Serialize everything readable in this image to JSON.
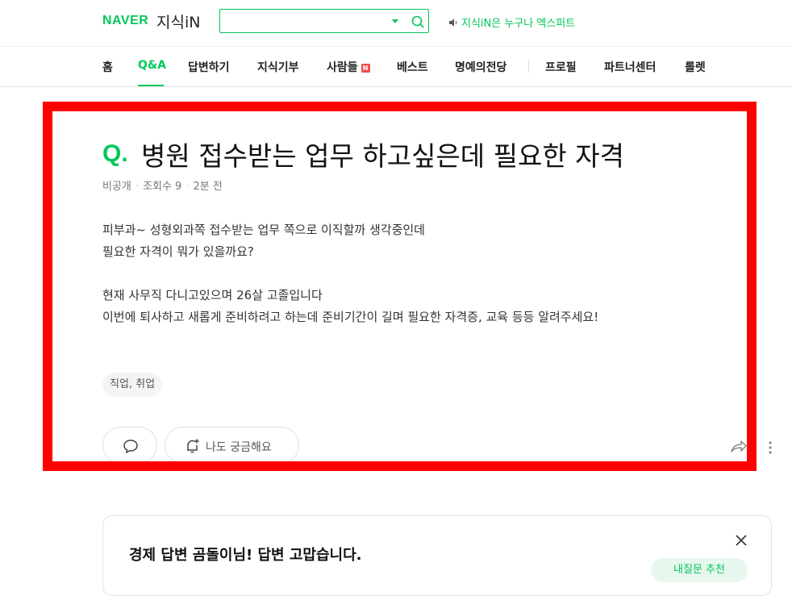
{
  "header": {
    "logo_naver": "NAVER",
    "logo_jisik": "지식iN",
    "expert_text": "지식iN은 누구나 엑스퍼트"
  },
  "nav": {
    "items": [
      {
        "label": "홈"
      },
      {
        "label": "Q&A"
      },
      {
        "label": "답변하기"
      },
      {
        "label": "지식기부"
      },
      {
        "label": "사람들"
      },
      {
        "label": "베스트"
      },
      {
        "label": "명예의전당"
      },
      {
        "label": "프로필"
      },
      {
        "label": "파트너센터"
      },
      {
        "label": "롤렛"
      }
    ],
    "active": "Q&A",
    "new_badge": "N"
  },
  "question": {
    "q_mark": "Q.",
    "title": "병원 접수받는 업무 하고싶은데 필요한 자격",
    "author": "비공개",
    "views": "조회수 9",
    "time": "2분 전",
    "body": [
      "피부과~ 성형외과쪽 접수받는 업무 쪽으로 이직할까 생각중인데",
      "필요한 자격이 뭐가 있을까요?",
      "",
      "현재 사무직 다니고있으며 26살 고졸입니다",
      "이번에 퇴사하고 새롭게 준비하려고 하는데 준비기간이 길며 필요한 자격증, 교육 등등 알려주세요!"
    ],
    "tag": "직업, 취업",
    "curious_label": "나도 궁금해요"
  },
  "card": {
    "title": "경제 답변 곰돌이님! 답변 고맙습니다.",
    "button_label": "내질문 추천"
  },
  "colors": {
    "brand": "#03c75a",
    "highlight": "#ff0000",
    "badge": "#f04e4e"
  },
  "icons": [
    "search-icon",
    "caret-down-icon",
    "speaker-icon",
    "comment-icon",
    "bell-plus-icon",
    "share-icon",
    "more-vertical-icon",
    "close-icon"
  ]
}
